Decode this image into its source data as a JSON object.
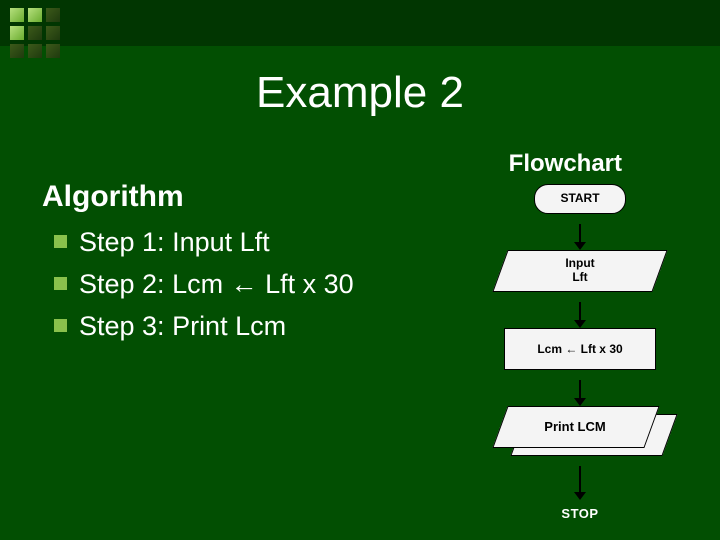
{
  "title": "Example 2",
  "flowchart_label": "Flowchart",
  "algorithm_label": "Algorithm",
  "steps": [
    "Step 1:  Input Lft",
    "Step 2:  Lcm ← Lft x 30",
    "Step 3:  Print Lcm"
  ],
  "chart_data": {
    "type": "flowchart",
    "nodes": [
      {
        "id": "start",
        "shape": "terminator",
        "text": "START"
      },
      {
        "id": "input",
        "shape": "io",
        "text": "Input\nLft"
      },
      {
        "id": "process",
        "shape": "process",
        "text": "Lcm ← Lft x 30"
      },
      {
        "id": "output",
        "shape": "io",
        "text": "Print  LCM"
      },
      {
        "id": "stop",
        "shape": "terminator",
        "text": "STOP"
      }
    ],
    "edges": [
      [
        "start",
        "input"
      ],
      [
        "input",
        "process"
      ],
      [
        "process",
        "output"
      ],
      [
        "output",
        "stop"
      ]
    ]
  }
}
